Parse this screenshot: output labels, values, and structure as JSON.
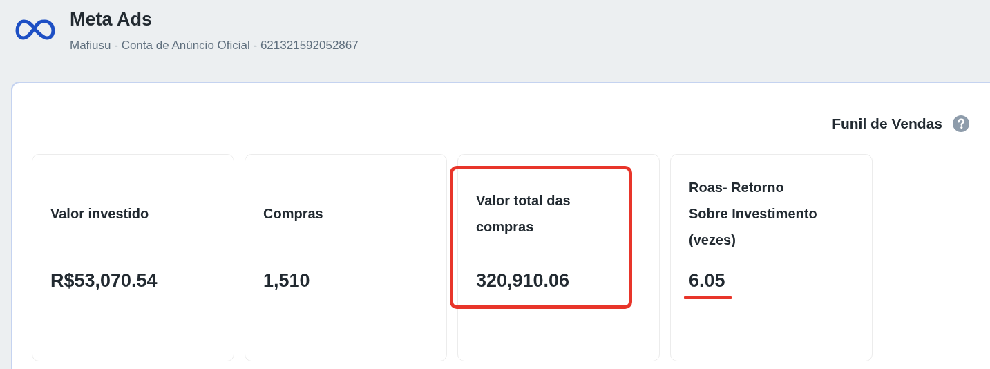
{
  "header": {
    "title": "Meta Ads",
    "subtitle": "Mafiusu - Conta de Anúncio Oficial - 621321592052867"
  },
  "panel": {
    "title": "Funil de Vendas",
    "cards": [
      {
        "label": "Valor investido",
        "value": "R$53,070.54",
        "boxed": false,
        "underlined": false
      },
      {
        "label": "Compras",
        "value": "1,510",
        "boxed": false,
        "underlined": false
      },
      {
        "label": "Valor total das compras",
        "value": "320,910.06",
        "boxed": true,
        "underlined": false
      },
      {
        "label": "Roas- Retorno Sobre Investimento (vezes)",
        "value": "6.05",
        "boxed": false,
        "underlined": true
      }
    ]
  }
}
